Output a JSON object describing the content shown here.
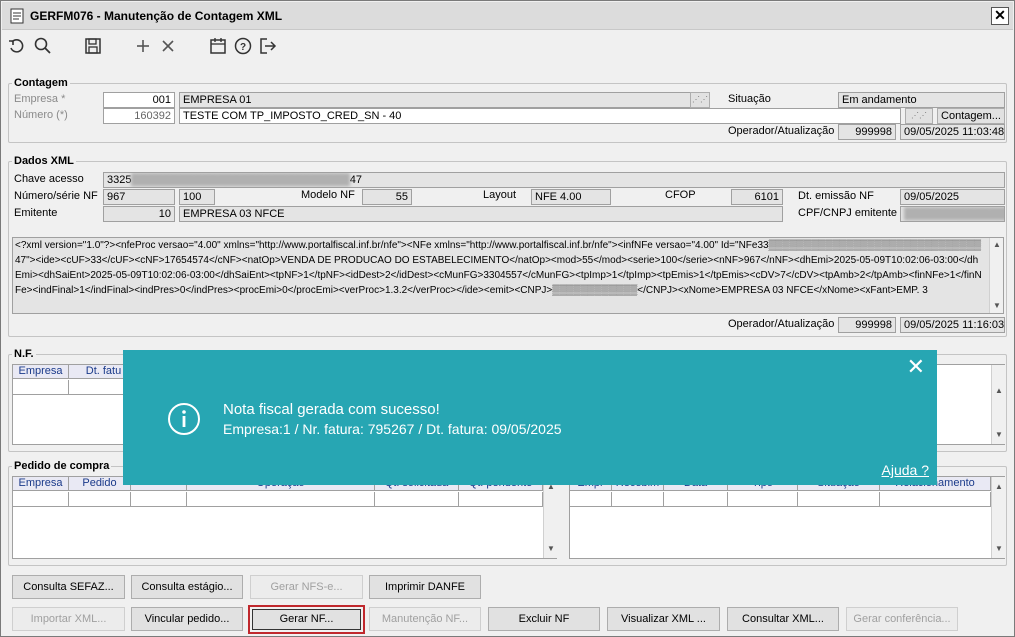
{
  "window": {
    "title": "GERFM076 - Manutenção de Contagem XML"
  },
  "toolbar": {
    "icons": [
      "undo-icon",
      "search-icon",
      "save-icon",
      "add-icon",
      "delete-icon",
      "calendar-icon",
      "help-icon",
      "exit-icon"
    ]
  },
  "contagem": {
    "legend": "Contagem",
    "empresa_label": "Empresa *",
    "empresa_code": "001",
    "empresa_name": "EMPRESA 01",
    "numero_label": "Número (*)",
    "numero_value": "160392",
    "numero_desc": "TESTE COM TP_IMPOSTO_CRED_SN - 40",
    "situacao_label": "Situação",
    "situacao_value": "Em andamento",
    "contagem_button": "Contagem...",
    "operador_label": "Operador/Atualização",
    "operador_value": "999998",
    "atualizacao_value": "09/05/2025 11:03:48"
  },
  "dados_xml": {
    "legend": "Dados XML",
    "chave_label": "Chave acesso",
    "chave_prefix": "3325",
    "chave_suffix": "47",
    "numero_serie_label": "Número/série NF",
    "numero_nf": "967",
    "serie_nf": "100",
    "modelo_label": "Modelo NF",
    "modelo_value": "55",
    "layout_label": "Layout",
    "layout_value": "NFE 4.00",
    "cfop_label": "CFOP",
    "cfop_value": "6101",
    "dt_emissao_label": "Dt. emissão NF",
    "dt_emissao_value": "09/05/2025",
    "emitente_label": "Emitente",
    "emitente_code": "10",
    "emitente_name": "EMPRESA 03 NFCE",
    "cpf_label": "CPF/CNPJ emitente",
    "xml_text": "<?xml version=\"1.0\"?><nfeProc versao=\"4.00\" xmlns=\"http://www.portalfiscal.inf.br/nfe\"><NFe xmlns=\"http://www.portalfiscal.inf.br/nfe\"><infNFe versao=\"4.00\" Id=\"NFe33▒▒▒▒▒▒▒▒▒▒▒▒▒▒▒▒▒▒▒▒▒▒▒▒▒▒▒▒▒▒47\"><ide><cUF>33</cUF><cNF>17654574</cNF><natOp>VENDA DE PRODUCAO DO ESTABELECIMENTO</natOp><mod>55</mod><serie>100</serie><nNF>967</nNF><dhEmi>2025-05-09T10:02:06-03:00</dhEmi><dhSaiEnt>2025-05-09T10:02:06-03:00</dhSaiEnt><tpNF>1</tpNF><idDest>2</idDest><cMunFG>3304557</cMunFG><tpImp>1</tpImp><tpEmis>1</tpEmis><cDV>7</cDV><tpAmb>2</tpAmb><finNFe>1</finNFe><indFinal>1</indFinal><indPres>0</indPres><procEmi>0</procEmi><verProc>1.3.2</verProc></ide><emit><CNPJ>▒▒▒▒▒▒▒▒▒▒▒▒</CNPJ><xNome>EMPRESA 03 NFCE</xNome><xFant>EMP. 3",
    "operador_label": "Operador/Atualização",
    "operador_value": "999998",
    "atualizacao_value": "09/05/2025 11:16:03"
  },
  "nf": {
    "legend": "N.F.",
    "columns": [
      "Empresa",
      "Dt. fatu"
    ]
  },
  "pedido": {
    "legend": "Pedido de compra",
    "columns": [
      "Empresa",
      "Pedido",
      "",
      "Operação",
      "Qt. solicitada",
      "Qt. pendente"
    ]
  },
  "right_grid": {
    "columns": [
      "Empr",
      "Recebim",
      "Data",
      "Tipo",
      "Situação",
      "Relacionamento"
    ]
  },
  "toast": {
    "line1": "Nota fiscal gerada com sucesso!",
    "line2": "Empresa:1 / Nr. fatura: 795267 / Dt. fatura: 09/05/2025",
    "help": "Ajuda ?",
    "close": "✕"
  },
  "buttons_row1": [
    {
      "label": "Consulta SEFAZ...",
      "enabled": true
    },
    {
      "label": "Consulta estágio...",
      "enabled": true
    },
    {
      "label": "Gerar NFS-e...",
      "enabled": false
    },
    {
      "label": "Imprimir DANFE",
      "enabled": true
    }
  ],
  "buttons_row2": [
    {
      "label": "Importar XML...",
      "enabled": false
    },
    {
      "label": "Vincular pedido...",
      "enabled": true
    },
    {
      "label": "Gerar NF...",
      "enabled": true
    },
    {
      "label": "Manutenção NF...",
      "enabled": false
    },
    {
      "label": "Excluir NF",
      "enabled": true
    },
    {
      "label": "Visualizar XML ...",
      "enabled": true
    },
    {
      "label": "Consultar XML...",
      "enabled": true
    },
    {
      "label": "Gerar conferência...",
      "enabled": false
    }
  ],
  "colors": {
    "toast_bg": "#27a6b3",
    "focus_outline": "#c0282d",
    "grid_header_text": "#1a3a8a"
  }
}
